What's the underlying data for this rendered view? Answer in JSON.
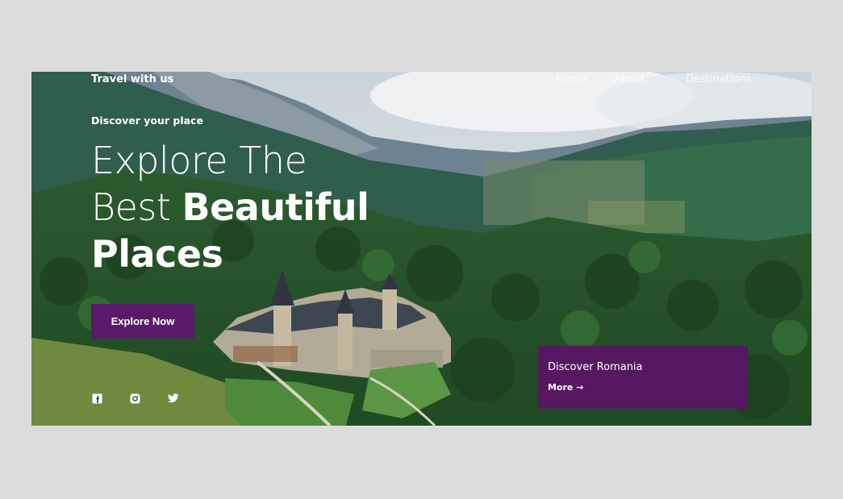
{
  "nav": {
    "brand": "Travel with us",
    "links": [
      "Home",
      "About",
      "Destinations"
    ]
  },
  "hero": {
    "subtitle": "Discover your place",
    "headline_line1": "Explore The",
    "headline_line2_light": "Best ",
    "headline_line2_bold": "Beautiful",
    "headline_line3_bold": "Places",
    "cta_label": "Explore Now"
  },
  "social": [
    "facebook-icon",
    "instagram-icon",
    "twitter-icon"
  ],
  "card": {
    "title": "Discover Romania",
    "more_label": "More",
    "more_arrow": "→"
  },
  "colors": {
    "accent": "#5a1a6a",
    "card_bg": "#551861",
    "page_bg": "#dcdcdc"
  }
}
